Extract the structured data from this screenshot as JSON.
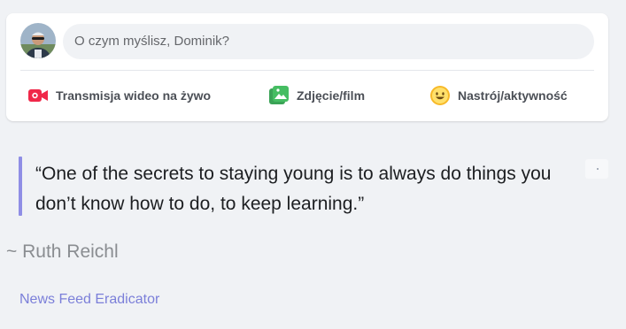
{
  "composer": {
    "prompt_placeholder": "O czym myślisz, Dominik?",
    "actions": [
      {
        "label": "Transmisja wideo na żywo",
        "icon": "live-video-icon",
        "color": "#f02849"
      },
      {
        "label": "Zdjęcie/film",
        "icon": "photo-icon",
        "color": "#45bd62"
      },
      {
        "label": "Nastrój/aktywność",
        "icon": "feeling-icon",
        "color": "#f7b928"
      }
    ]
  },
  "quote": {
    "text": "“One of the secrets to staying young is to always do things you don’t know how to do, to keep learning.”",
    "author": "~ Ruth Reichl"
  },
  "footer": {
    "link_label": "News Feed Eradicator"
  },
  "colors": {
    "accent": "#8f8ee5",
    "link": "#7b7fd9",
    "page_background": "#f0f2f5"
  }
}
